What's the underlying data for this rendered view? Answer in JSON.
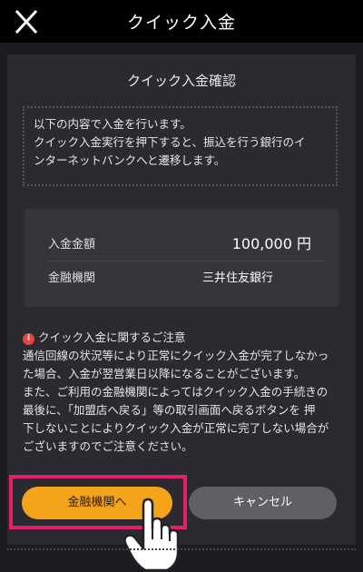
{
  "header": {
    "title": "クイック入金"
  },
  "confirm": {
    "title": "クイック入金確認"
  },
  "notice": {
    "lines": [
      "以下の内容で入金を行います。",
      "クイック入金実行を押下すると、振込を行う銀行のイ",
      "ンターネットバンクへと遷移します。"
    ]
  },
  "summary": {
    "amount_label": "入金金額",
    "amount_value": "100,000 円",
    "institution_label": "金融機関",
    "institution_value": "三井住友銀行"
  },
  "caution": {
    "icon_glyph": "i",
    "title": "クイック入金に関するご注意",
    "lines": [
      "通信回線の状況等により正常にクイック入金が完了しなかっ",
      "た場合、入金が翌営業日以降になることがございます。",
      "また、ご利用の金融機関によってはクイック入金の手続きの",
      "最後に、「加盟店へ戻る」等の取引画面へ戻るボタンを 押",
      "下しないことによりクイック入金が正常に完了しない場合が",
      "ございますのでご注意ください。"
    ]
  },
  "buttons": {
    "primary_label": "金融機関へ",
    "secondary_label": "キャンセル"
  },
  "colors": {
    "accent": "#f5a31a",
    "highlight": "#e3206b",
    "info": "#e8453c"
  },
  "icons": {
    "close": "close-icon",
    "info": "info-icon",
    "pointer": "hand-pointer-icon"
  }
}
